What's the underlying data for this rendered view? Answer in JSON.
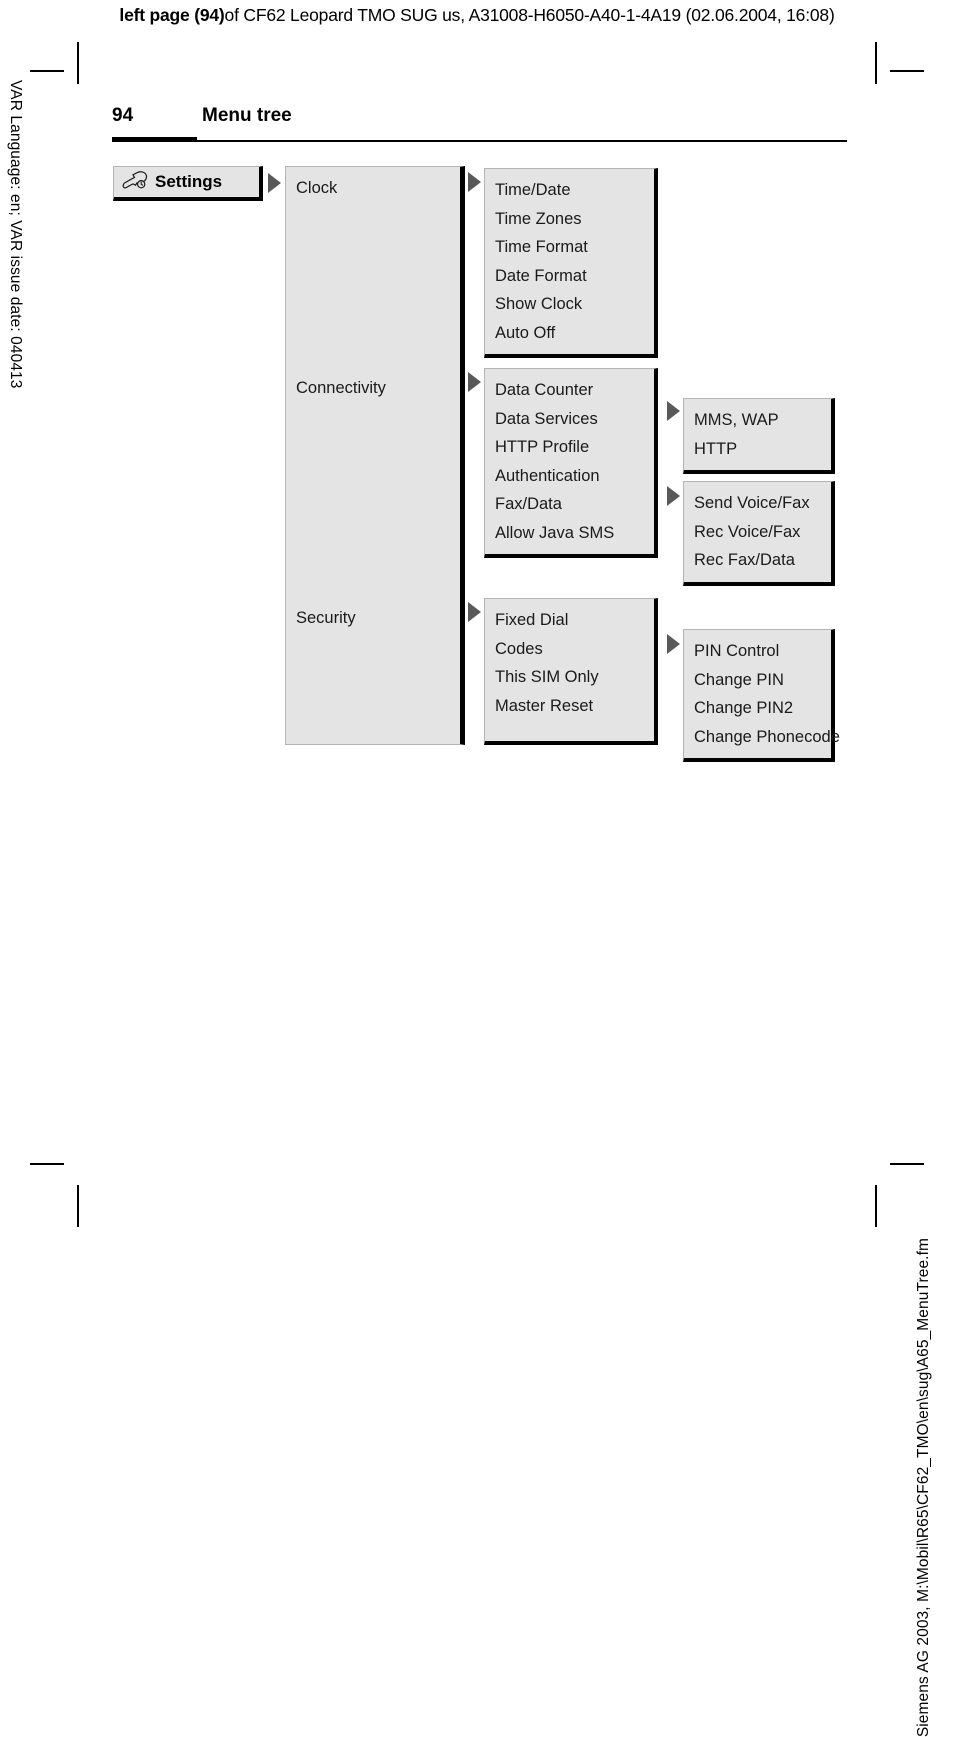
{
  "production_header": {
    "bold_part": "left page (94)",
    "rest": " of CF62 Leopard TMO SUG us, A31008-H6050-A40-1-4A19 (02.06.2004, 16:08)"
  },
  "side_text": {
    "left": "VAR Language: en; VAR issue date: 040413",
    "right": "Siemens AG 2003, M:\\Mobil\\R65\\CF62_TMO\\en\\sug\\A65_MenuTree.fm"
  },
  "page_header": {
    "page_number": "94",
    "title": "Menu tree"
  },
  "colors": {
    "node_fill": "#e4e4e4",
    "node_border_dark": "#000000",
    "node_border_light": "#b4b4b4",
    "arrow": "#595959"
  },
  "tree": {
    "root": {
      "icon": "wrench-icon",
      "label": "Settings"
    },
    "level1": [
      {
        "label": "Clock"
      },
      {
        "label": "Connectivity"
      },
      {
        "label": "Security"
      }
    ],
    "clock_items": [
      "Time/Date",
      "Time Zones",
      "Time Format",
      "Date Format",
      "Show Clock",
      "Auto Off"
    ],
    "connectivity_items": [
      "Data Counter",
      "Data Services",
      "HTTP Profile",
      "Authentication",
      "Fax/Data",
      "Allow Java SMS"
    ],
    "security_items": [
      "Fixed Dial",
      "Codes",
      "This SIM Only",
      "Master Reset"
    ],
    "data_services_items": [
      "MMS, WAP",
      "HTTP"
    ],
    "fax_data_items": [
      "Send Voice/Fax",
      "Rec Voice/Fax",
      "Rec Fax/Data"
    ],
    "codes_items": [
      "PIN Control",
      "Change PIN",
      "Change PIN2",
      "Change Phonecode"
    ]
  }
}
